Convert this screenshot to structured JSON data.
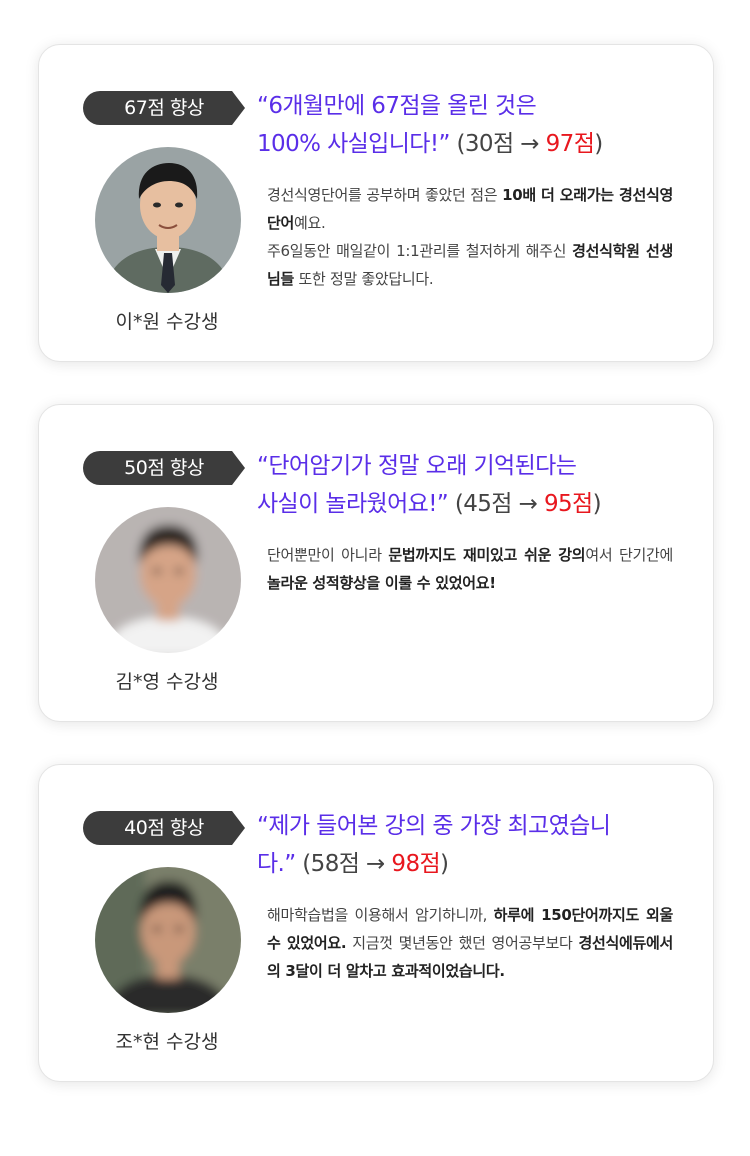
{
  "testimonials": [
    {
      "badge": "67점 향상",
      "name": "이*원 수강생",
      "headline_1": "“6개월만에 67점을 올린 것은",
      "headline_2": "100% 사실입니다!”",
      "score_open": " (30점 → ",
      "score_final": "97점",
      "score_close": ")",
      "body": [
        {
          "t": "경선식영단어를 공부하며 좋았던 점은 ",
          "b": false
        },
        {
          "t": "10배 더 오래가는 경선식영단어",
          "b": true
        },
        {
          "t": "예요.",
          "b": false
        },
        {
          "t": "\n주6일동안 매일같이 1:1관리를 철저하게 해주신 ",
          "b": false
        },
        {
          "t": "경선식학원 선생님들",
          "b": true
        },
        {
          "t": " 또한 정말 좋았답니다.",
          "b": false
        }
      ],
      "photo": {
        "bg": "#9aa3a4",
        "suit": "#5f6b61",
        "skin": "#e7bfa0",
        "hair": "#1a1a1a",
        "tie": "#262a33"
      }
    },
    {
      "badge": "50점 향상",
      "name": "김*영 수강생",
      "headline_1": "“단어암기가 정말 오래 기억된다는",
      "headline_2": "사실이 놀라웠어요!”",
      "score_open": " (45점 → ",
      "score_final": "95점",
      "score_close": ")",
      "body": [
        {
          "t": "단어뿐만이 아니라 ",
          "b": false
        },
        {
          "t": "문법까지도 재미있고 쉬운 강의",
          "b": true
        },
        {
          "t": "여서 단기간에 ",
          "b": false
        },
        {
          "t": "놀라운 성적향상을 이룰 수 있었어요!",
          "b": true
        }
      ],
      "photo": {
        "bg": "#b9b4b2",
        "suit": "#f2f2f2",
        "skin": "#d6a487",
        "hair": "#2d2622",
        "tie": ""
      }
    },
    {
      "badge": "40점 향상",
      "name": "조*현 수강생",
      "headline_1": "“제가 들어본 강의 중 가장 최고였습니",
      "headline_2": "다.”",
      "score_open": " (58점 → ",
      "score_final": "98점",
      "score_close": ")",
      "body": [
        {
          "t": "해마학습법을 이용해서 암기하니까, ",
          "b": false
        },
        {
          "t": "하루에 150단어까지도 외울 수 있었어요.",
          "b": true
        },
        {
          "t": " 지금껏 몇년동안 했던 영어공부보다 ",
          "b": false
        },
        {
          "t": "경선식에듀에서의 3달이 더 알차고 효과적이었습니다.",
          "b": true
        }
      ],
      "photo": {
        "bg": "#7a7f6a",
        "suit": "#2b2b2b",
        "skin": "#c9987a",
        "hair": "#1d1c1b",
        "tie": ""
      }
    }
  ]
}
